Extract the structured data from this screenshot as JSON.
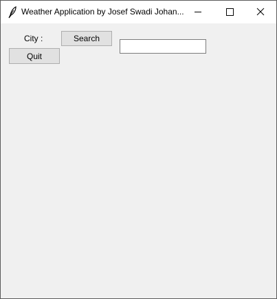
{
  "window": {
    "title": "Weather Application by Josef Swadi Johan...",
    "app_icon": "feather-icon",
    "controls": {
      "minimize_icon": "minimize-icon",
      "maximize_icon": "maximize-icon",
      "close_icon": "close-icon"
    }
  },
  "form": {
    "city_label": "City :",
    "search_label": "Search",
    "quit_label": "Quit",
    "city_value": "",
    "city_placeholder": ""
  },
  "colors": {
    "client_background": "#f0f0f0",
    "titlebar_background": "#ffffff",
    "button_background": "#e1e1e1",
    "button_border": "#adadad"
  }
}
